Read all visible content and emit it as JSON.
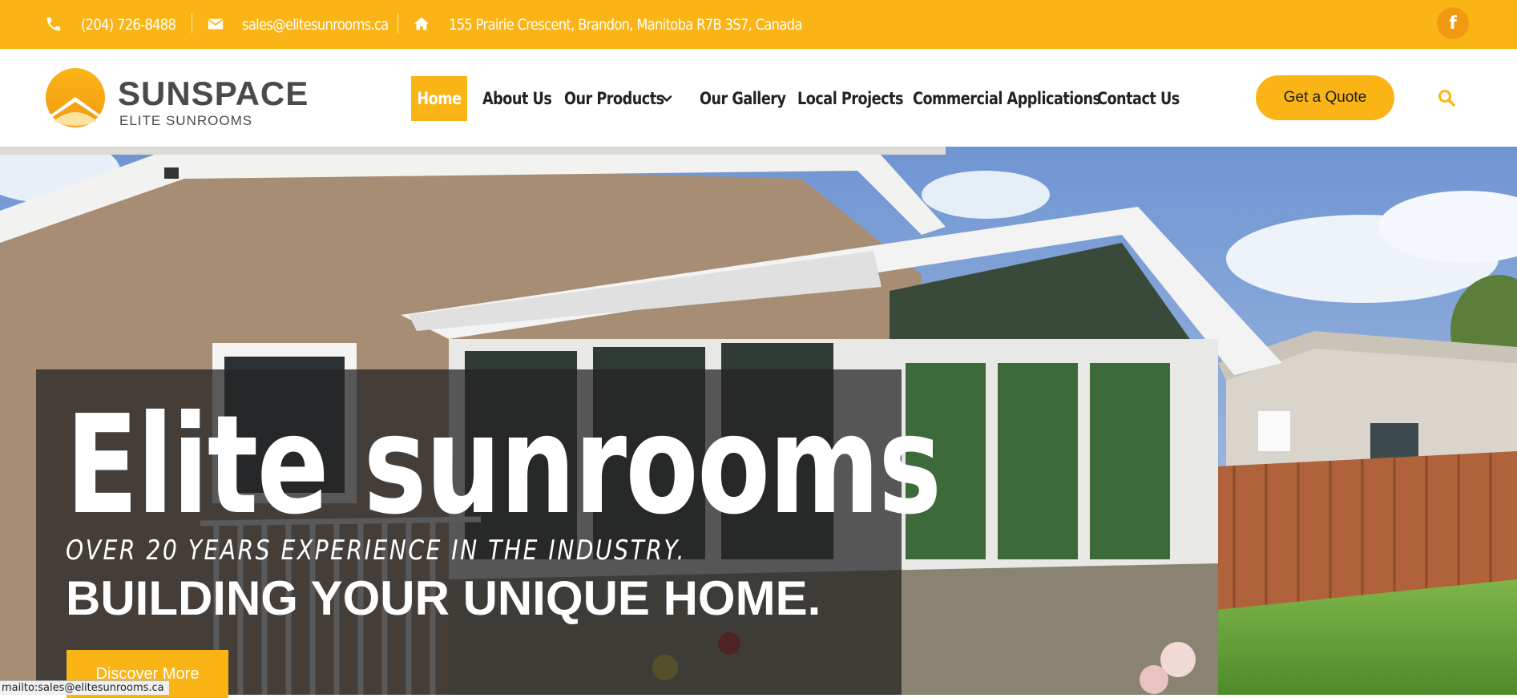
{
  "colors": {
    "brand": "#fbb416",
    "text": "#222222",
    "white": "#ffffff"
  },
  "topbar": {
    "phone_icon": "phone-icon",
    "phone": "(204) 726-8488",
    "email_icon": "envelope-icon",
    "email": "sales@elitesunrooms.ca",
    "address_icon": "home-icon",
    "address": "155 Prairie Crescent, Brandon, Manitoba R7B 3S7, Canada",
    "social_icon": "facebook-icon",
    "social_glyph": "f"
  },
  "logo": {
    "title": "SUNSPACE",
    "subtitle": "ELITE SUNROOMS"
  },
  "nav": {
    "items": [
      {
        "label": "Home",
        "active": true
      },
      {
        "label": "About Us"
      },
      {
        "label": "Our Products",
        "has_dropdown": true
      },
      {
        "label": "Our Gallery"
      },
      {
        "label": "Local Projects"
      },
      {
        "label": "Commercial Applications"
      },
      {
        "label": "Contact Us"
      }
    ],
    "cta_label": "Get a Quote",
    "search_icon": "search-icon"
  },
  "hero": {
    "title": "Elite sunrooms",
    "subtitle": "OVER 20 YEARS EXPERIENCE IN THE INDUSTRY.",
    "tagline": "BUILDING YOUR UNIQUE HOME.",
    "button_label": "Discover More"
  },
  "status_bar": {
    "text": "mailto:sales@elitesunrooms.ca"
  }
}
